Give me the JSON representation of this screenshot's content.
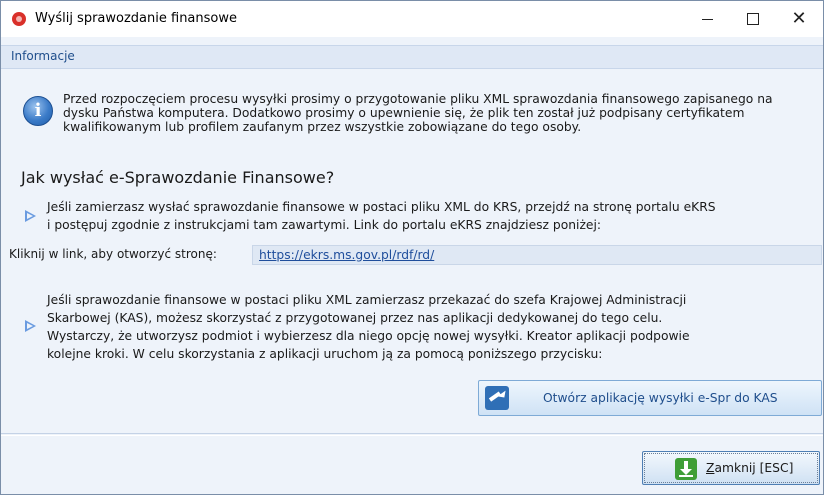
{
  "window": {
    "title": "Wyślij sprawozdanie finansowe",
    "controls": {
      "minimize": "—",
      "maximize": "☐",
      "close": "✕"
    }
  },
  "menu": {
    "label": "Informacje"
  },
  "info": {
    "icon": "info-icon",
    "text": "Przed rozpoczęciem procesu wysyłki prosimy o przygotowanie pliku XML sprawozdania finansowego zapisanego na\ndysku Państwa komputera. Dodatkowo prosimy o upewnienie się, że plik ten został już podpisany certyfikatem\nkwalifikowanym lub profilem zaufanym przez wszystkie zobowiązane do tego osoby."
  },
  "section": {
    "heading": "Jak wysłać e-Sprawozdanie Finansowe?",
    "para1": "Jeśli zamierzasz wysłać sprawozdanie finansowe w postaci pliku XML do KRS, przejdź na stronę portalu eKRS\ni postępuj zgodnie z instrukcjami tam zawartymi. Link do portalu eKRS znajdziesz poniżej:",
    "link_label": "Kliknij w link, aby otworzyć stronę:",
    "link": "https://ekrs.ms.gov.pl/rdf/rd/",
    "para2": "Jeśli sprawozdanie finansowe w postaci pliku XML zamierzasz przekazać do szefa Krajowej Administracji\nSkarbowej (KAS), możesz skorzystać z przygotowanej przez nas aplikacji dedykowanej do tego celu.\nWystarczy, że utworzysz podmiot i wybierzesz dla niego opcję nowej wysyłki. Kreator aplikacji podpowie\nkolejne kroki. W celu skorzystania z aplikacji uruchom ją za pomocą poniższego przycisku:",
    "kas_button": "Otwórz aplikację wysyłki e-Spr do KAS"
  },
  "footer": {
    "close_underlined": "Z",
    "close_rest": "amknij [ESC]"
  },
  "colors": {
    "accent": "#1f4e8c",
    "background": "#eef3fa",
    "link": "#1f4e9c"
  }
}
